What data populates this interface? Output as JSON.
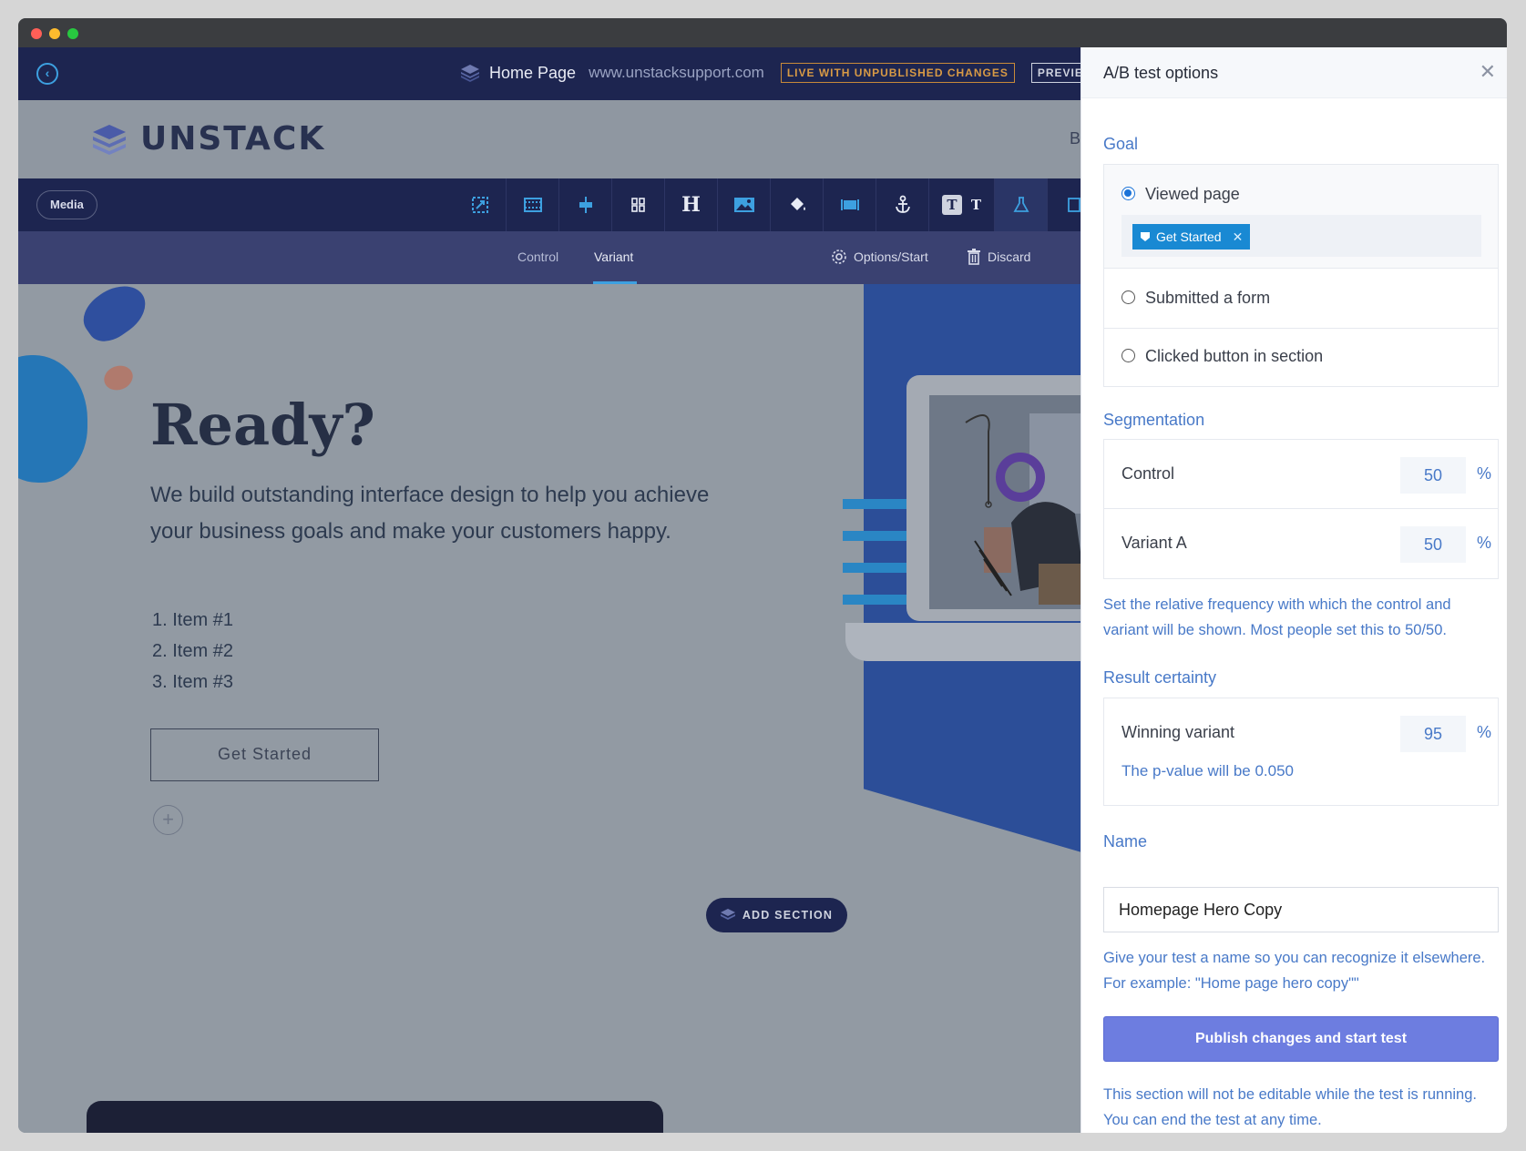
{
  "topbar": {
    "page_name": "Home Page",
    "page_url": "www.unstacksupport.com",
    "live_badge": "LIVE WITH UNPUBLISHED CHANGES",
    "preview_label": "PREVIEW"
  },
  "site": {
    "logo_text": "UNSTACK",
    "nav_partial": "B"
  },
  "toolbar": {
    "media_label": "Media",
    "tools": [
      "resize-icon",
      "section-layout-icon",
      "align-icon",
      "columns-icon",
      "heading-icon",
      "image-icon",
      "paint-bucket-icon",
      "fullwidth-icon",
      "anchor-icon",
      "text-style-icon",
      "ab-test-flask-icon"
    ],
    "heading_glyph": "H",
    "text_glyph": "T"
  },
  "variantbar": {
    "control_label": "Control",
    "variant_label": "Variant",
    "options_label": "Options/Start",
    "discard_label": "Discard"
  },
  "hero": {
    "heading": "Ready?",
    "copy": "We build outstanding interface design to help you achieve your business goals and make your customers happy.",
    "list": [
      "1. Item #1",
      "2. Item #2",
      "3. Item #3"
    ],
    "cta_label": "Get Started",
    "add_section_label": "ADD SECTION"
  },
  "panel": {
    "title": "A/B test options",
    "goal": {
      "label": "Goal",
      "options": [
        {
          "label": "Viewed page",
          "selected": true
        },
        {
          "label": "Submitted a form",
          "selected": false
        },
        {
          "label": "Clicked button in section",
          "selected": false
        }
      ],
      "tag_label": "Get Started"
    },
    "segmentation": {
      "label": "Segmentation",
      "rows": [
        {
          "label": "Control",
          "value": "50",
          "unit": "%"
        },
        {
          "label": "Variant A",
          "value": "50",
          "unit": "%"
        }
      ],
      "help": "Set the relative frequency with which the control and variant will be shown. Most people set this to 50/50."
    },
    "certainty": {
      "label": "Result certainty",
      "row_label": "Winning variant",
      "value": "95",
      "unit": "%",
      "pvalue_text": "The p-value will be 0.050"
    },
    "name": {
      "label": "Name",
      "value": "Homepage Hero Copy",
      "help": "Give your test a name so you can recognize it elsewhere. For example: \"Home page hero copy\"\""
    },
    "publish_label": "Publish changes and start test",
    "footer_help": "This section will not be editable while the test is running. You can end the test at any time."
  },
  "colors": {
    "navy": "#1d2550",
    "accent_blue": "#1989d3",
    "link_blue": "#4879c8",
    "publish_button": "#6d7de0"
  }
}
